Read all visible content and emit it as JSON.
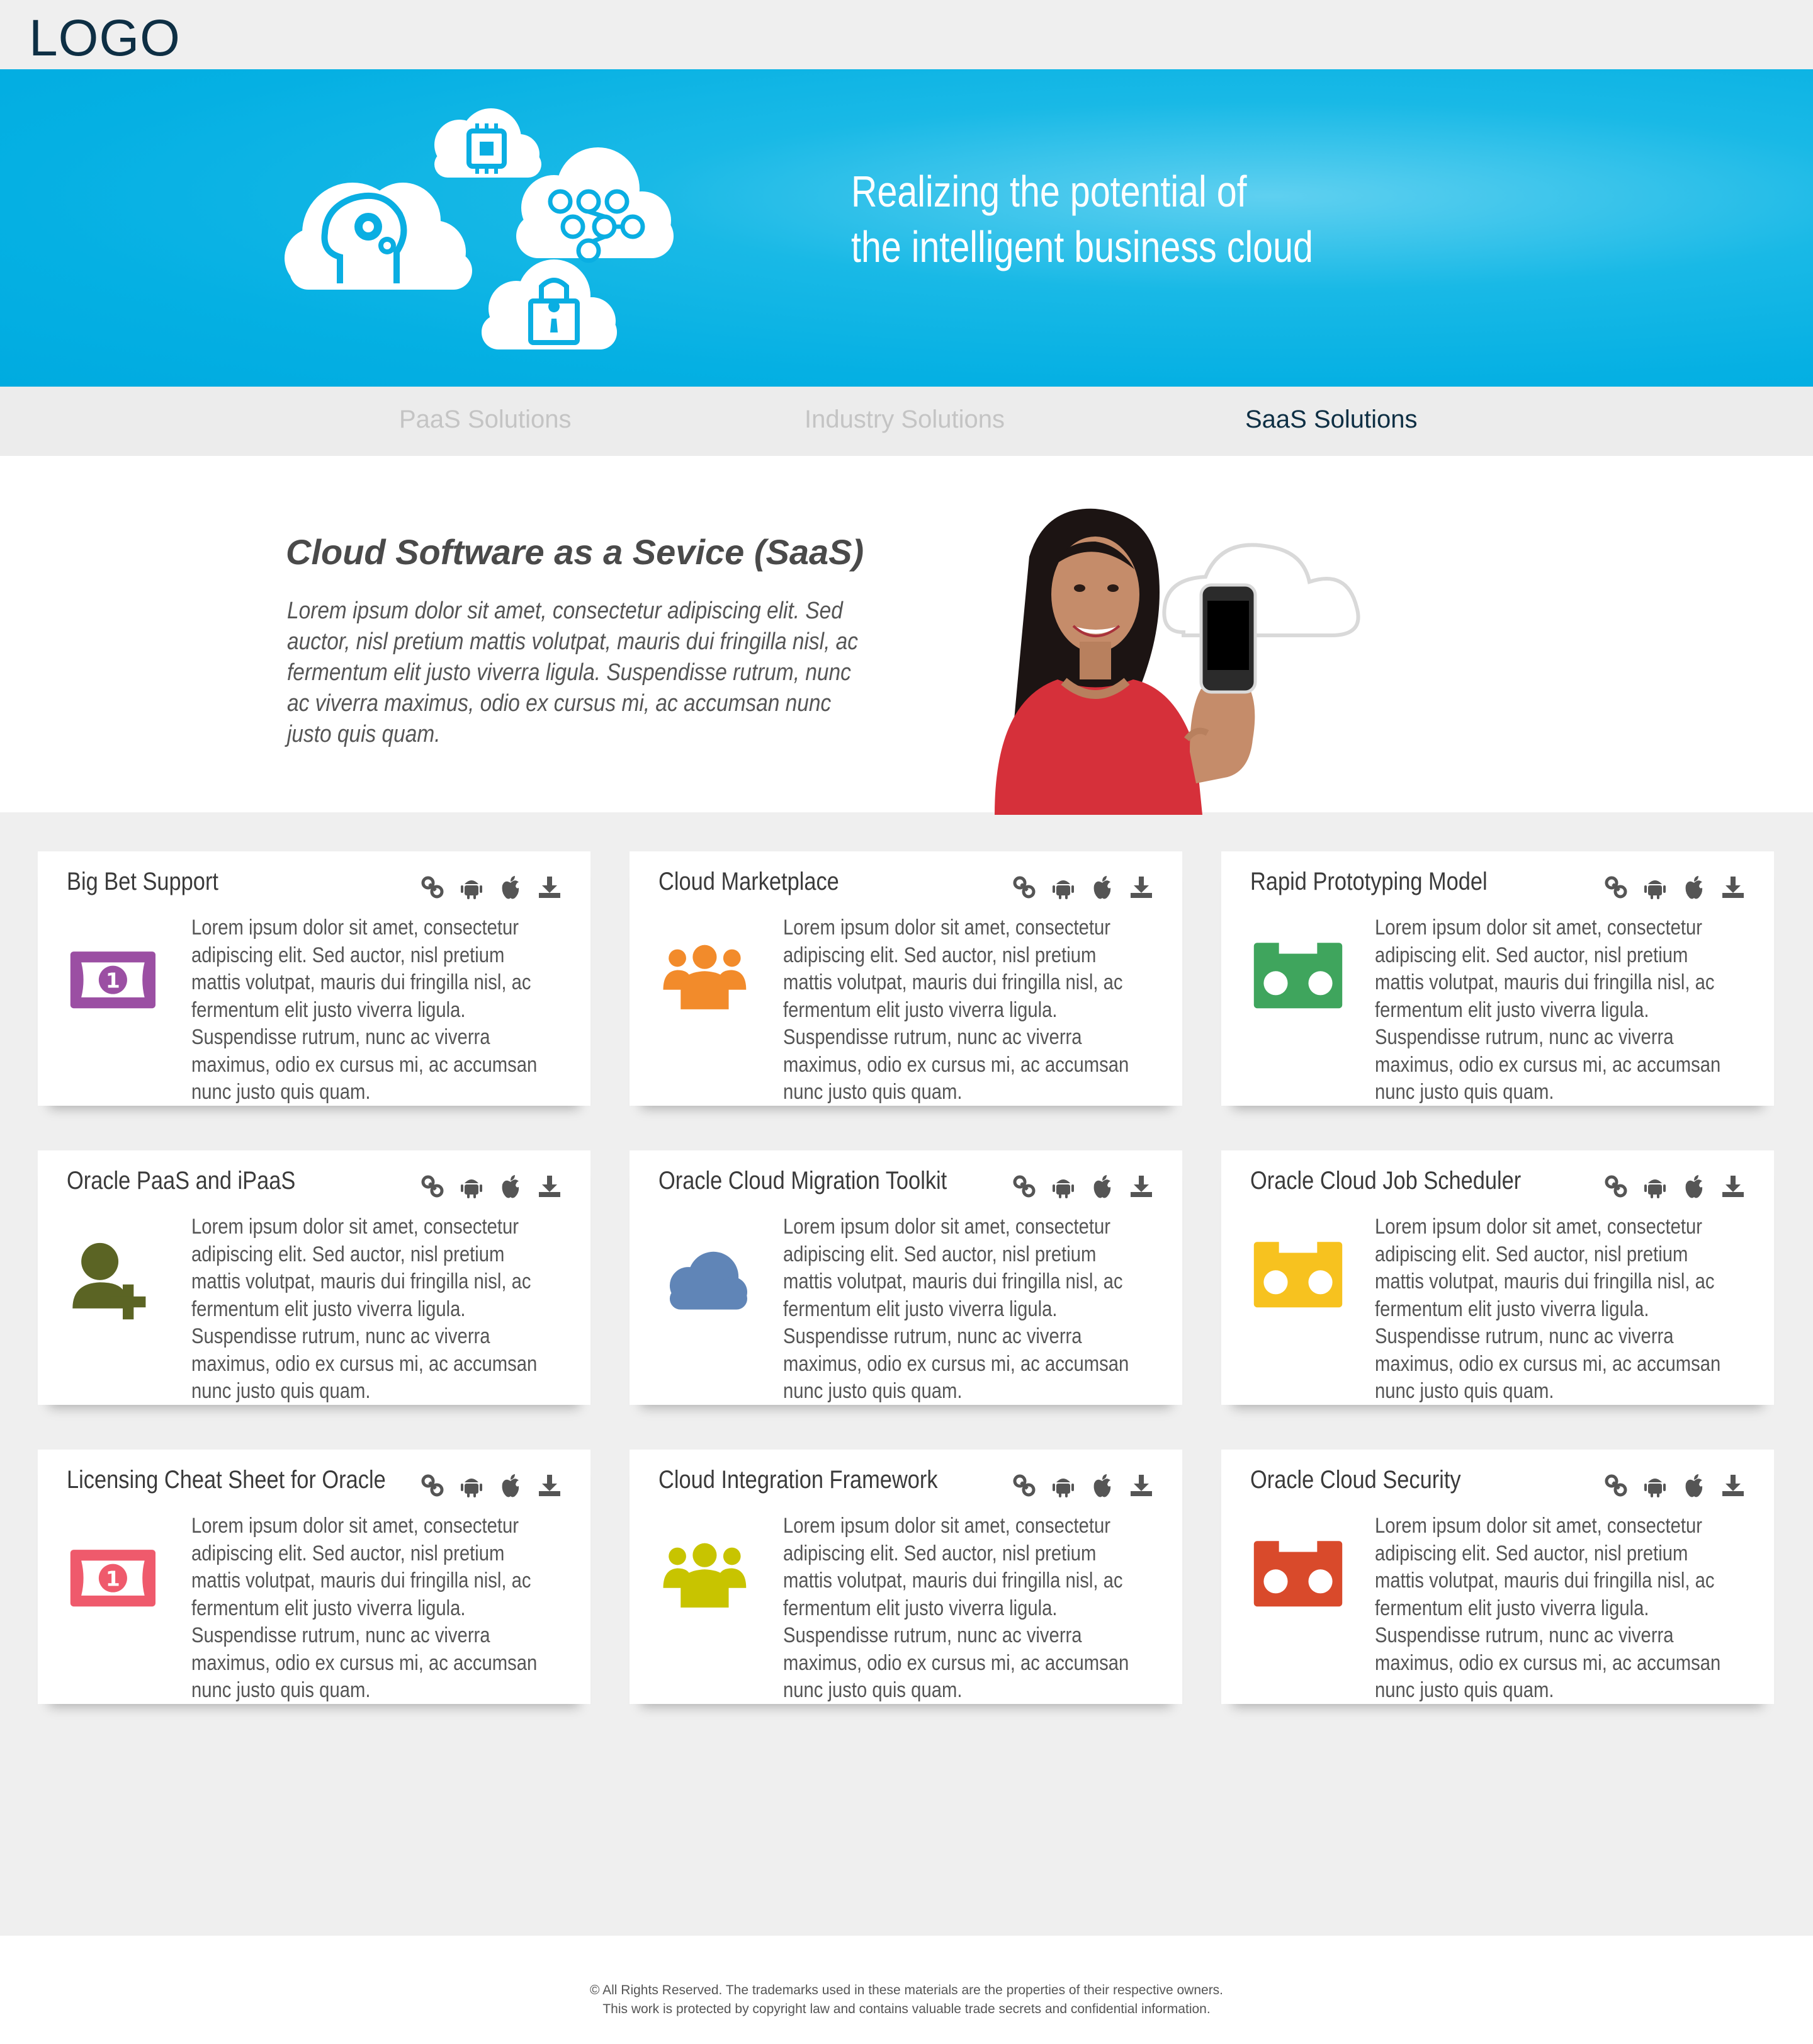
{
  "header": {
    "logo": "LOGO"
  },
  "hero": {
    "title_line1": "Realizing the potential of",
    "title_line2": "the intelligent business cloud"
  },
  "nav": {
    "items": [
      {
        "label": "PaaS Solutions"
      },
      {
        "label": "Industry Solutions"
      },
      {
        "label": "SaaS Solutions"
      }
    ],
    "active": "SaaS Solutions"
  },
  "intro": {
    "title": "Cloud Software as a Sevice (SaaS)",
    "text": "Lorem ipsum dolor sit amet, consectetur adipiscing elit. Sed auctor, nisl pretium mattis volutpat, mauris dui fringilla nisl, ac fermentum elit justo viverra ligula. Suspendisse rutrum, nunc ac viverra maximus, odio ex cursus mi, ac accumsan nunc justo quis quam."
  },
  "card_text": "Lorem ipsum dolor sit amet, consectetur adipiscing elit. Sed auctor, nisl pretium mattis volutpat, mauris dui fringilla nisl, ac fermentum elit justo viverra ligula. Suspendisse rutrum, nunc ac viverra maximus, odio ex cursus mi, ac accumsan nunc justo quis quam.",
  "card_actions": [
    "link-icon",
    "android-icon",
    "apple-icon",
    "download-icon"
  ],
  "cards": [
    {
      "title": "Big Bet Support",
      "icon": "money-bill-icon",
      "color": "#9b4fa3"
    },
    {
      "title": "Cloud Marketplace",
      "icon": "users-icon",
      "color": "#f28b2b"
    },
    {
      "title": "Rapid Prototyping Model",
      "icon": "box-icon",
      "color": "#3fa55d"
    },
    {
      "title": "Oracle PaaS and iPaaS",
      "icon": "user-plus-icon",
      "color": "#5b6424"
    },
    {
      "title": "Oracle Cloud Migration Toolkit",
      "icon": "cloud-icon",
      "color": "#6085b7"
    },
    {
      "title": "Oracle Cloud Job Scheduler",
      "icon": "box-icon",
      "color": "#f7c21f"
    },
    {
      "title": "Licensing Cheat Sheet for Oracle",
      "icon": "money-bill-icon",
      "color": "#ef5a6c"
    },
    {
      "title": "Cloud Integration Framework",
      "icon": "users-icon",
      "color": "#c8c400"
    },
    {
      "title": "Oracle Cloud Security",
      "icon": "box-icon",
      "color": "#d94a2b"
    }
  ],
  "colors": {
    "hero": "#00abe0",
    "logo": "#0e2f44",
    "nav_active": "#0e2f44",
    "nav_inactive": "#c4c4c4"
  },
  "footer": {
    "line1": "© All Rights Reserved. The trademarks used in these materials are the properties of their respective owners.",
    "line2": "This work is protected by copyright law and contains valuable trade secrets and confidential information."
  }
}
